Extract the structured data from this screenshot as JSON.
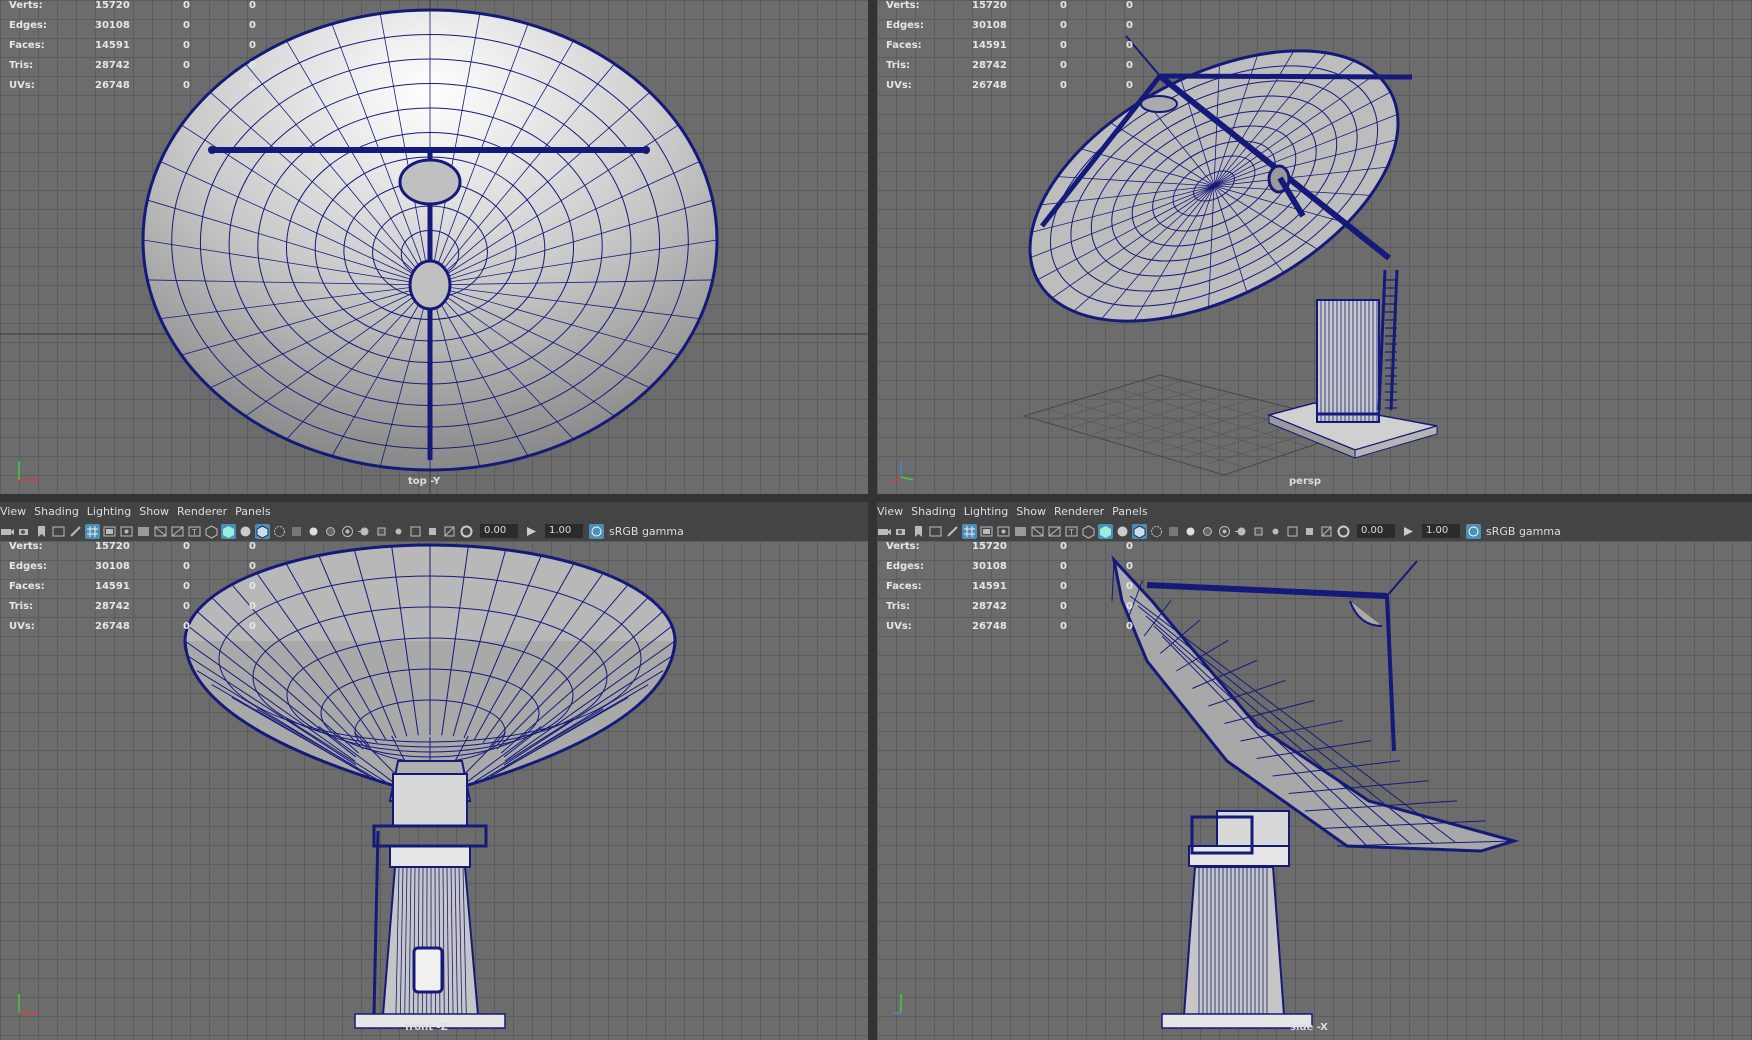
{
  "stats": {
    "labels": [
      "Verts:",
      "Edges:",
      "Faces:",
      "Tris:",
      "UVs:"
    ],
    "values": [
      [
        "15720",
        "0",
        "0"
      ],
      [
        "30108",
        "0",
        "0"
      ],
      [
        "14591",
        "0",
        "0"
      ],
      [
        "28742",
        "0",
        "0"
      ],
      [
        "26748",
        "0",
        "0"
      ]
    ]
  },
  "menu": [
    "View",
    "Shading",
    "Lighting",
    "Show",
    "Renderer",
    "Panels"
  ],
  "toolbar": {
    "value1": "0.00",
    "value2": "1.00",
    "color_management": "sRGB gamma"
  },
  "viewports": {
    "top": {
      "camera": "top -Y"
    },
    "persp": {
      "camera": "persp"
    },
    "front": {
      "camera": "front -Z"
    },
    "side": {
      "camera": "side -X"
    }
  },
  "colors": {
    "wire": "#151a7a",
    "viewport_bg": "#6c6c6c",
    "grid": "#5c5c5c",
    "ui_bg": "#444444",
    "active_icon": "#4c8fb8"
  }
}
